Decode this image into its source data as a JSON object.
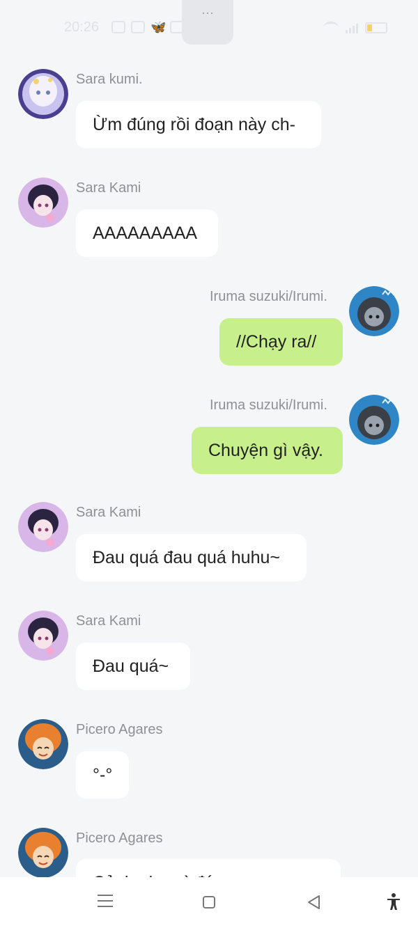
{
  "status_bar": {
    "time": "20:26",
    "notch_text": "···"
  },
  "messages": [
    {
      "sender": "Sara kumi.",
      "text": "Ừm đúng rồi đoạn này ch-",
      "side": "left",
      "avatar": "anime-girl-white-hair-avatar"
    },
    {
      "sender": "Sara Kami",
      "text": "AAAAAAAAA",
      "side": "left",
      "avatar": "anime-girl-black-hair-avatar"
    },
    {
      "sender": "Iruma suzuki/Irumi.",
      "text": "//Chạy ra//",
      "side": "right",
      "avatar": "anime-boy-blue-avatar"
    },
    {
      "sender": "Iruma suzuki/Irumi.",
      "text": "Chuyện gì vậy.",
      "side": "right",
      "avatar": "anime-boy-blue-avatar"
    },
    {
      "sender": "Sara Kami",
      "text": "Đau quá đau quá huhu~",
      "side": "left",
      "avatar": "anime-girl-black-hair-avatar"
    },
    {
      "sender": "Sara Kami",
      "text": "Đau quá~",
      "side": "left",
      "avatar": "anime-girl-black-hair-avatar"
    },
    {
      "sender": "Picero Agares",
      "text": "°-°",
      "side": "left",
      "avatar": "anime-boy-orange-hair-avatar"
    },
    {
      "sender": "Picero Agares",
      "text": "Cảnh như gì đó ...",
      "side": "left",
      "avatar": "anime-boy-orange-hair-avatar"
    }
  ],
  "nav_bar": {
    "icons": [
      "menu-icon",
      "home-icon",
      "back-icon",
      "accessibility-icon"
    ]
  },
  "colors": {
    "background": "#f5f6f8",
    "left_bubble": "#ffffff",
    "right_bubble": "#c7f08c",
    "name_text": "#8f9094"
  }
}
